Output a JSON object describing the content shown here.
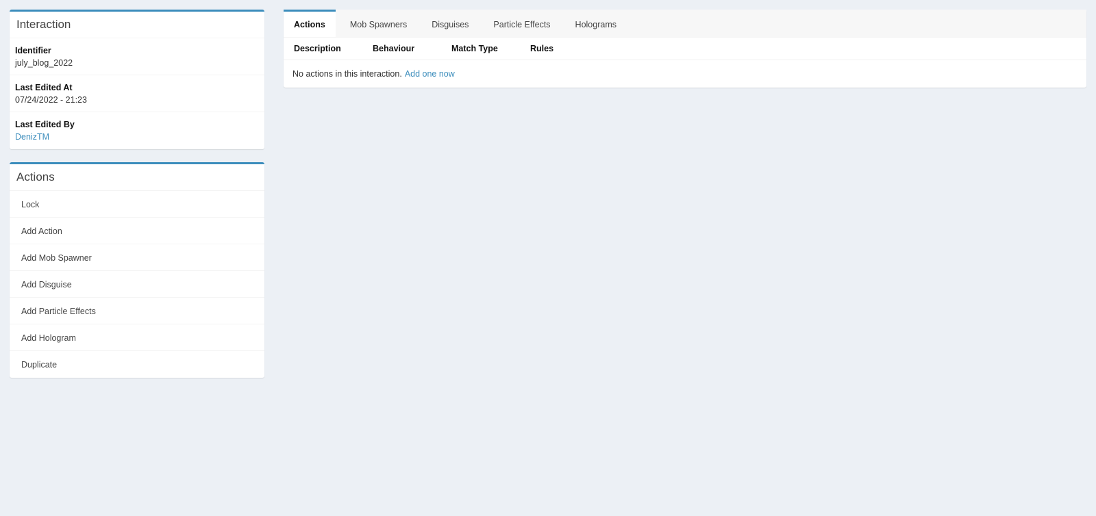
{
  "interaction_box": {
    "title": "Interaction",
    "fields": [
      {
        "label": "Identifier",
        "value": "july_blog_2022"
      },
      {
        "label": "Last Edited At",
        "value": "07/24/2022 - 21:23"
      },
      {
        "label": "Last Edited By",
        "value": "DenizTM"
      }
    ]
  },
  "actions_box": {
    "title": "Actions",
    "items": [
      "Lock",
      "Add Action",
      "Add Mob Spawner",
      "Add Disguise",
      "Add Particle Effects",
      "Add Hologram",
      "Duplicate"
    ]
  },
  "tabs": [
    {
      "label": "Actions",
      "active": true
    },
    {
      "label": "Mob Spawners",
      "active": false
    },
    {
      "label": "Disguises",
      "active": false
    },
    {
      "label": "Particle Effects",
      "active": false
    },
    {
      "label": "Holograms",
      "active": false
    }
  ],
  "table": {
    "columns": [
      "Description",
      "Behaviour",
      "Match Type",
      "Rules"
    ],
    "empty_text": "No actions in this interaction.",
    "empty_link": "Add one now"
  },
  "colors": {
    "accent": "#3c8dbc",
    "background": "#ecf0f5"
  }
}
